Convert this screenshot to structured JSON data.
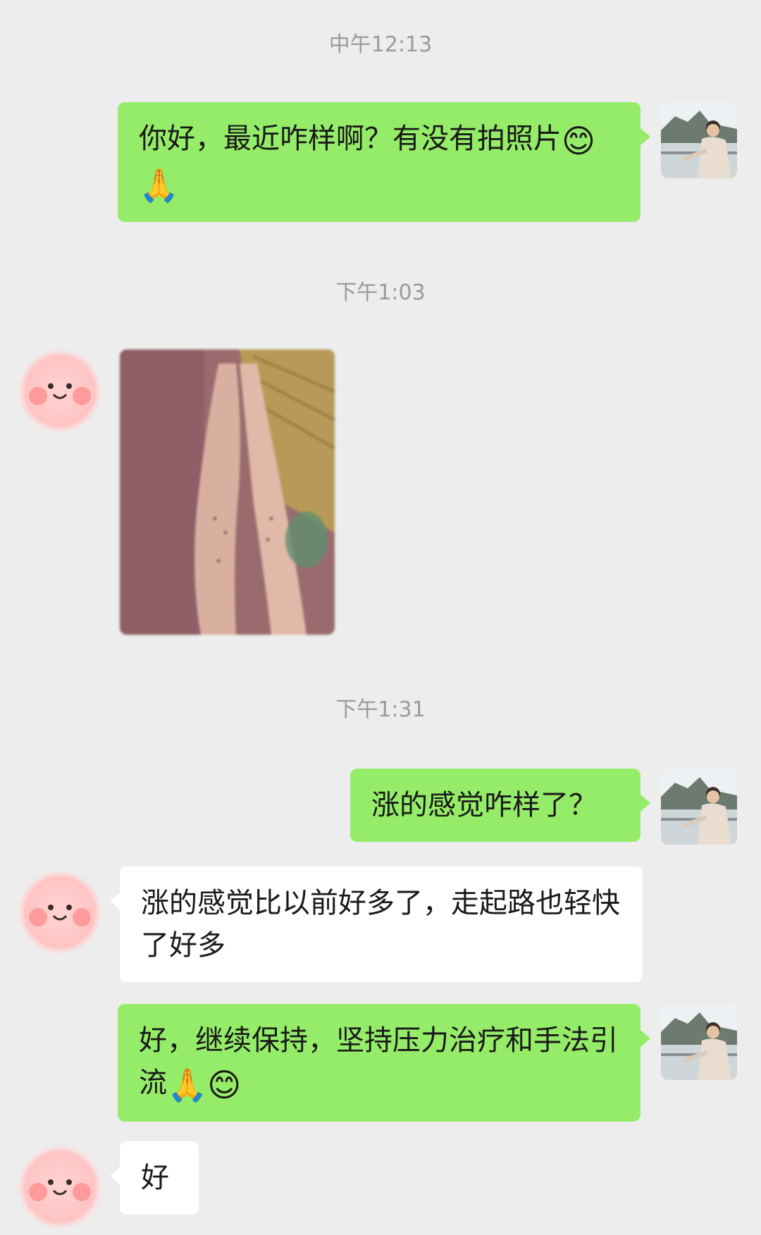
{
  "timestamps": [
    "中午12:13",
    "下午1:03",
    "下午1:31"
  ],
  "messages": [
    {
      "sender": "me",
      "text": "你好，最近咋样啊？有没有拍照片",
      "emojis": "😊🙏"
    },
    {
      "sender": "other",
      "type": "photo"
    },
    {
      "sender": "me",
      "text": "涨的感觉咋样了？"
    },
    {
      "sender": "other",
      "text": "涨的感觉比以前好多了，走起路也轻快了好多"
    },
    {
      "sender": "me",
      "text": "好，继续保持，坚持压力治疗和手法引流",
      "emojis": "🙏😊"
    },
    {
      "sender": "other",
      "text": "好"
    }
  ],
  "colors": {
    "background": "#ededed",
    "my_bubble": "#95ec69",
    "other_bubble": "#ffffff",
    "timestamp": "#9a9a9a"
  },
  "icons": {
    "my_avatar": "man-by-railing-avatar",
    "other_avatar": "pink-smiley-avatar"
  }
}
